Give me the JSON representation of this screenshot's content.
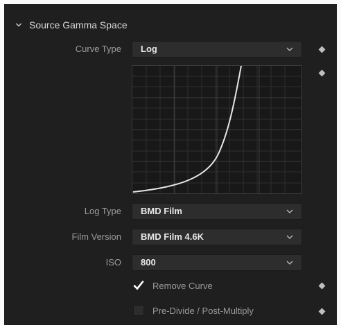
{
  "section": {
    "title": "Source Gamma Space",
    "icon": "chevron-down-icon"
  },
  "curve_type": {
    "label": "Curve Type",
    "value": "Log"
  },
  "log_type": {
    "label": "Log Type",
    "value": "BMD Film"
  },
  "film_version": {
    "label": "Film Version",
    "value": "BMD Film 4.6K"
  },
  "iso": {
    "label": "ISO",
    "value": "800"
  },
  "remove_curve": {
    "label": "Remove Curve",
    "checked": true
  },
  "pre_divide": {
    "label": "Pre-Divide / Post-Multiply",
    "checked": false
  },
  "colors": {
    "panel": "#1f1f1f",
    "field": "#2d2d2d",
    "curve": "#e6e6e6",
    "text": "#9c9c9c"
  }
}
